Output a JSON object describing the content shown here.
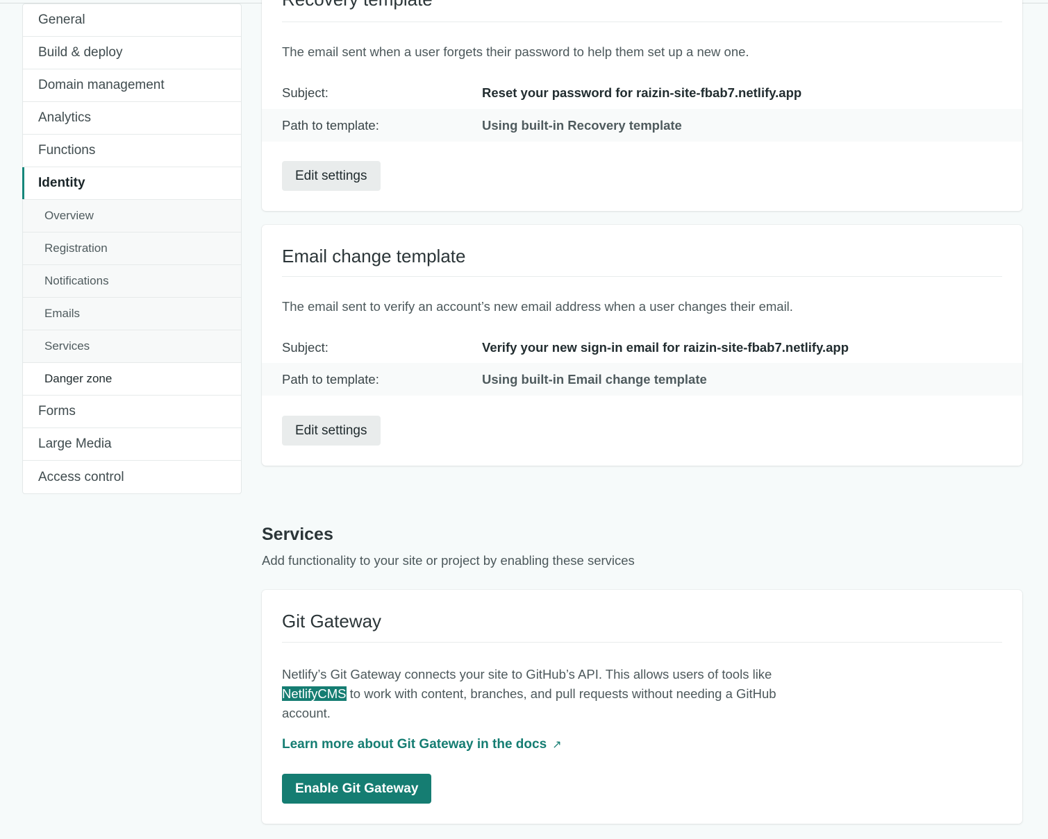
{
  "sidebar": {
    "items": [
      {
        "label": "General"
      },
      {
        "label": "Build & deploy"
      },
      {
        "label": "Domain management"
      },
      {
        "label": "Analytics"
      },
      {
        "label": "Functions"
      },
      {
        "label": "Identity"
      }
    ],
    "identity_sub": [
      {
        "label": "Overview"
      },
      {
        "label": "Registration"
      },
      {
        "label": "Notifications"
      },
      {
        "label": "Emails"
      },
      {
        "label": "Services"
      },
      {
        "label": "Danger zone"
      }
    ],
    "items_after": [
      {
        "label": "Forms"
      },
      {
        "label": "Large Media"
      },
      {
        "label": "Access control"
      }
    ]
  },
  "recovery": {
    "title": "Recovery template",
    "description": "The email sent when a user forgets their password to help them set up a new one.",
    "subject_label": "Subject:",
    "subject_value": "Reset your password for raizin-site-fbab7.netlify.app",
    "path_label": "Path to template:",
    "path_value": "Using built-in Recovery template",
    "button": "Edit settings"
  },
  "email_change": {
    "title": "Email change template",
    "description": "The email sent to verify an account’s new email address when a user changes their email.",
    "subject_label": "Subject:",
    "subject_value": "Verify your new sign-in email for raizin-site-fbab7.netlify.app",
    "path_label": "Path to template:",
    "path_value": "Using built-in Email change template",
    "button": "Edit settings"
  },
  "services": {
    "title": "Services",
    "subtitle": "Add functionality to your site or project by enabling these services"
  },
  "git_gateway": {
    "title": "Git Gateway",
    "desc_part1": "Netlify’s Git Gateway connects your site to GitHub’s API. This allows users of tools like ",
    "desc_highlight": "NetlifyCMS",
    "desc_part2": " to work with content, branches, and pull requests without needing a GitHub account.",
    "link": "Learn more about Git Gateway in the docs",
    "link_icon": "external-arrow-icon",
    "button": "Enable Git Gateway"
  },
  "colors": {
    "accent": "#157d72",
    "background": "#f6fafa"
  }
}
